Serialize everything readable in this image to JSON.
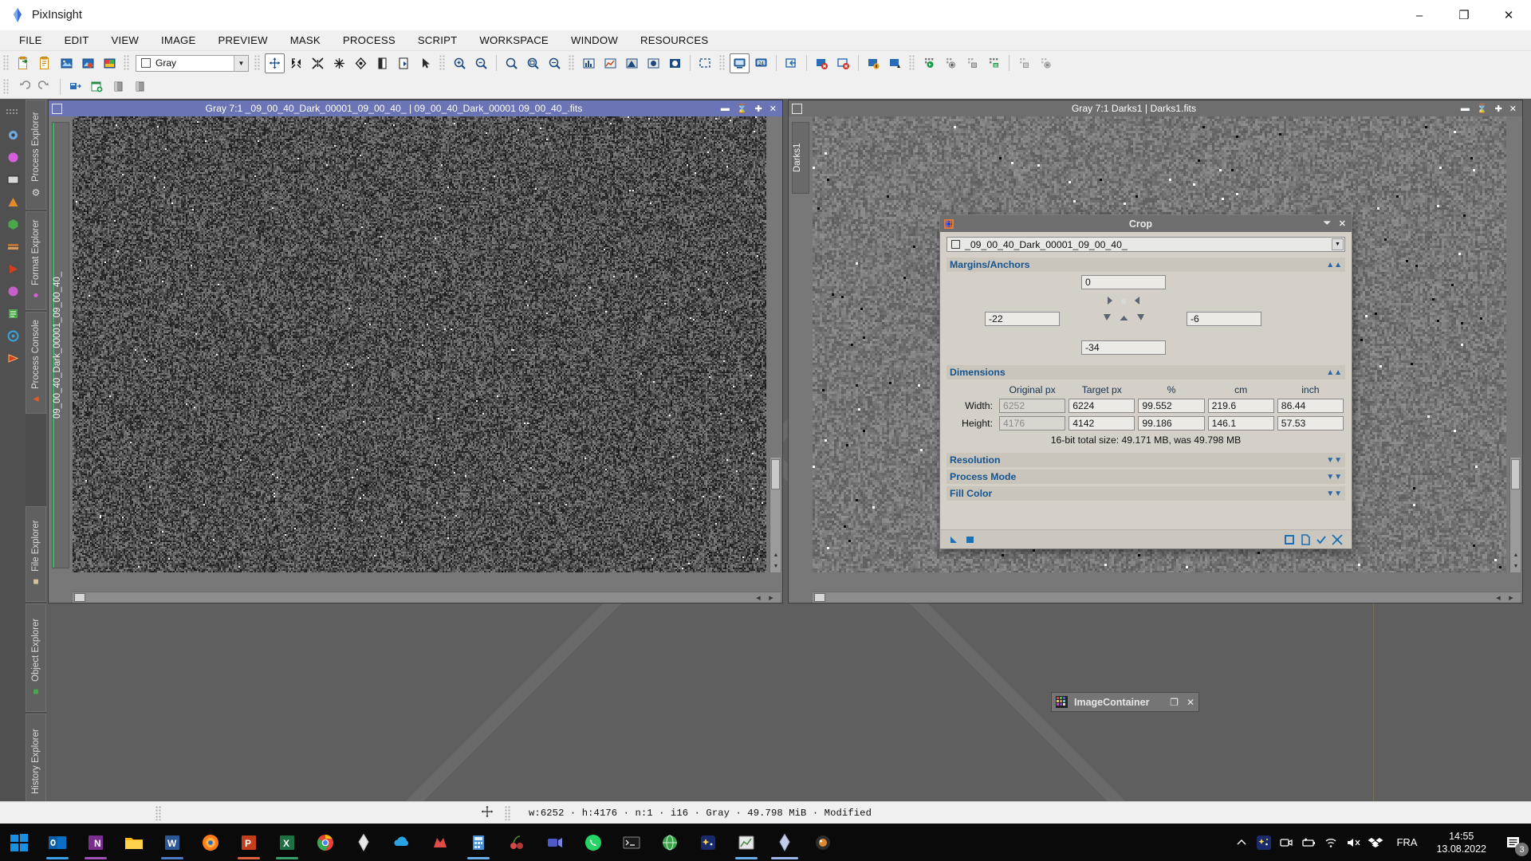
{
  "window": {
    "app_title": "PixInsight",
    "app_icon": "pixinsight-diamond-icon",
    "controls": {
      "minimize": "–",
      "maximize": "❐",
      "close": "✕"
    }
  },
  "menubar": {
    "items": [
      "FILE",
      "EDIT",
      "VIEW",
      "IMAGE",
      "PREVIEW",
      "MASK",
      "PROCESS",
      "SCRIPT",
      "WORKSPACE",
      "WINDOW",
      "RESOURCES"
    ]
  },
  "toolbar1": {
    "combo_value": "Gray",
    "icons": [
      "new-image-icon",
      "duplicate-image-icon",
      "open-image-icon",
      "save-image-icon",
      "save-as-image-icon",
      "pan-tool-icon",
      "expand-tool-icon",
      "collapse-tool-icon",
      "shrink-tool-icon",
      "dynamic-tool-icon",
      "readout-tool-icon",
      "preview-tool-icon",
      "arrow-tool-icon",
      "zoom-in-icon",
      "zoom-out-icon",
      "zoom-1-1-icon",
      "zoom-fit-icon",
      "zoom-optimal-icon",
      "histogram-icon",
      "statistics-icon",
      "screen-transfer-icon",
      "mask-icon",
      "mask-invert-icon",
      "monitor-icon",
      "monitor-24-icon",
      "window-import-icon",
      "window-close-icon",
      "window-close-all-icon",
      "window-undo-icon",
      "window-redo-icon",
      "process-run-icon",
      "process-add-icon",
      "process-save-icon",
      "process-edit-icon",
      "project-save-icon",
      "project-close-icon"
    ]
  },
  "toolbar2": {
    "icons": [
      "undo-icon",
      "redo-icon",
      "window-tile-icon",
      "window-new-icon",
      "preview-a-icon",
      "preview-b-icon"
    ]
  },
  "dock_left": {
    "icons": [
      "grip-icon",
      "gear-blue-icon",
      "magenta-circle-icon",
      "square-icon",
      "orange-triangle-icon",
      "cube-icon",
      "stack-icon",
      "play-red-icon",
      "magenta-dot-icon",
      "green-doc-icon",
      "target-icon",
      "red-arrow-icon"
    ],
    "tabs_top": [
      {
        "label": "Process Explorer",
        "icon": "gear-icon"
      },
      {
        "label": "Format Explorer",
        "icon": "magenta-circle-icon"
      },
      {
        "label": "Process Console",
        "icon": "red-play-icon"
      }
    ],
    "tabs_bottom": [
      {
        "label": "File Explorer",
        "icon": "drum-icon"
      },
      {
        "label": "Object Explorer",
        "icon": "green-cube-icon"
      },
      {
        "label": "History Explorer",
        "icon": "orange-flame-icon"
      }
    ]
  },
  "image_windows": [
    {
      "id": "left",
      "title": "Gray 7:1 _09_00_40_Dark_00001_09_00_40_ | 09_00_40_Dark_00001 09_00_40_.fits",
      "active": true,
      "vertical_tab": "09_00_40_Dark_00001_09_00_40_",
      "controls": [
        "minimize",
        "restore",
        "maximize",
        "close"
      ]
    },
    {
      "id": "right",
      "title": "Gray 7:1 Darks1 | Darks1.fits",
      "active": false,
      "vertical_tab": "Darks1",
      "controls": [
        "minimize",
        "restore",
        "maximize",
        "close"
      ]
    }
  ],
  "crop_dialog": {
    "title": "Crop",
    "icon": "crop-icon",
    "controls": {
      "collapse": "⏷",
      "close": "✕"
    },
    "view_selector": {
      "value": "_09_00_40_Dark_00001_09_00_40_",
      "icon": "view-icon"
    },
    "sections": {
      "margins": {
        "label": "Margins/Anchors",
        "top": "0",
        "left": "-22",
        "right": "-6",
        "bottom": "-34"
      },
      "dimensions": {
        "label": "Dimensions",
        "headers": [
          "",
          "Original px",
          "Target px",
          "%",
          "cm",
          "inch"
        ],
        "rows": [
          {
            "label": "Width:",
            "original": "6252",
            "target": "6224",
            "percent": "99.552",
            "cm": "219.6",
            "inch": "86.44"
          },
          {
            "label": "Height:",
            "original": "4176",
            "target": "4142",
            "percent": "99.186",
            "cm": "146.1",
            "inch": "57.53"
          }
        ],
        "total_size": "16-bit total size: 49.171 MB, was 49.798 MB"
      },
      "resolution": {
        "label": "Resolution"
      },
      "process_mode": {
        "label": "Process Mode"
      },
      "fill_color": {
        "label": "Fill Color"
      }
    },
    "buttons": [
      "apply-global-icon",
      "execute-icon",
      "new-instance-icon",
      "browse-documentation-icon",
      "reset-icon",
      "ok-icon",
      "cancel-icon"
    ],
    "colors": {
      "section_text": "#16538f",
      "titlebar": "#6e6e6e",
      "face": "#d4d0c8"
    }
  },
  "image_container": {
    "title": "ImageContainer",
    "icon": "image-container-icon",
    "controls": {
      "maximize": "❐",
      "close": "✕"
    }
  },
  "statusbar": {
    "cursor_icon": "crosshair-icon",
    "text": "w:6252 · h:4176 · n:1 · i16 · Gray · 49.798 MiB · Modified"
  },
  "taskbar": {
    "start_label": "start-icon",
    "apps": [
      {
        "name": "outlook-icon",
        "color": "#0a6fc2"
      },
      {
        "name": "onenote-icon",
        "color": "#7a2f8f"
      },
      {
        "name": "file-explorer-icon",
        "color": "#ffb900"
      },
      {
        "name": "word-icon",
        "color": "#2b5797"
      },
      {
        "name": "firefox-icon",
        "color": "#ff6611"
      },
      {
        "name": "powerpoint-icon",
        "color": "#c43e1c"
      },
      {
        "name": "excel-icon",
        "color": "#1e7145"
      },
      {
        "name": "chrome-icon",
        "color": "#4285f4"
      },
      {
        "name": "pixinsight-taskbar-icon",
        "color": "#dddddd"
      },
      {
        "name": "onedrive-icon",
        "color": "#29a3e3"
      },
      {
        "name": "app-red-icon",
        "color": "#e04a4a"
      },
      {
        "name": "calculator-icon",
        "color": "#4a8fd6"
      },
      {
        "name": "cherry-app-icon",
        "color": "#d24b4b"
      },
      {
        "name": "teams-icon",
        "color": "#5059c9"
      },
      {
        "name": "whatsapp-icon",
        "color": "#25d366"
      },
      {
        "name": "terminal-icon",
        "color": "#1a1a1a"
      },
      {
        "name": "globe-icon",
        "color": "#3aa34a"
      },
      {
        "name": "stellarium-icon",
        "color": "#1b2a6b"
      },
      {
        "name": "editor-icon",
        "color": "#4d8c4d"
      },
      {
        "name": "pixinsight-active-icon",
        "color": "#b9c6e8"
      },
      {
        "name": "siril-icon",
        "color": "#d07b2a"
      }
    ],
    "tray": {
      "chevron": "show-hidden-icons",
      "icons": [
        "stellarium-tray-icon",
        "camera-tray-icon",
        "battery-icon",
        "wifi-icon",
        "volume-mute-icon",
        "dropbox-icon"
      ],
      "language": "FRA",
      "time": "14:55",
      "date": "13.08.2022",
      "notification_count": "3"
    }
  }
}
